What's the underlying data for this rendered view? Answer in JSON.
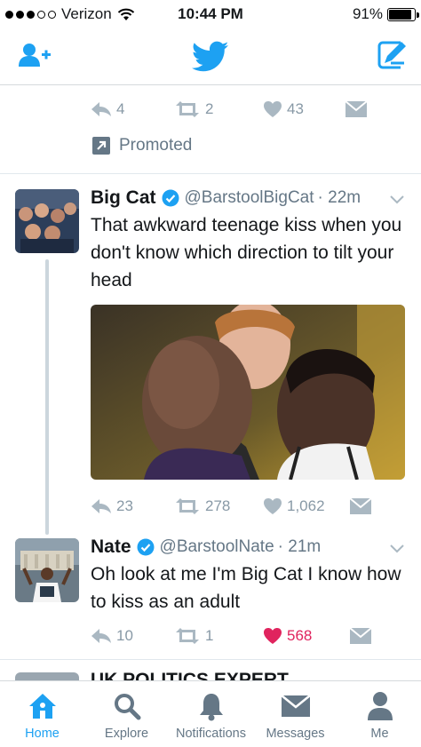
{
  "status_bar": {
    "carrier": "Verizon",
    "time": "10:44 PM",
    "battery": "91%",
    "battery_level": 0.91
  },
  "header": {
    "add_user_icon": "add-user-icon",
    "logo_icon": "twitter-bird-icon",
    "compose_icon": "compose-icon"
  },
  "colors": {
    "accent": "#1da1f2",
    "like_active": "#e0245e",
    "muted": "#8899a6"
  },
  "promoted_tweet": {
    "reply_count": "4",
    "retweet_count": "2",
    "like_count": "43",
    "promoted_label": "Promoted"
  },
  "tweets": [
    {
      "name": "Big Cat",
      "verified": true,
      "handle": "@BarstoolBigCat",
      "time": "· 22m",
      "text": "That awkward teenage kiss when you don't know which direction to tilt your head",
      "reply_count": "23",
      "retweet_count": "278",
      "like_count": "1,062",
      "liked": false
    },
    {
      "name": "Nate",
      "verified": true,
      "handle": "@BarstoolNate",
      "time": "· 21m",
      "text": "Oh look at me I'm Big Cat I know how to kiss as an adult",
      "reply_count": "10",
      "retweet_count": "1",
      "like_count": "568",
      "liked": true
    }
  ],
  "partial_tweet": {
    "name": "UK POLITICS EXPERT"
  },
  "tabs": [
    {
      "label": "Home",
      "icon": "home-icon",
      "active": true
    },
    {
      "label": "Explore",
      "icon": "search-icon",
      "active": false
    },
    {
      "label": "Notifications",
      "icon": "bell-icon",
      "active": false
    },
    {
      "label": "Messages",
      "icon": "envelope-icon",
      "active": false
    },
    {
      "label": "Me",
      "icon": "person-icon",
      "active": false
    }
  ]
}
